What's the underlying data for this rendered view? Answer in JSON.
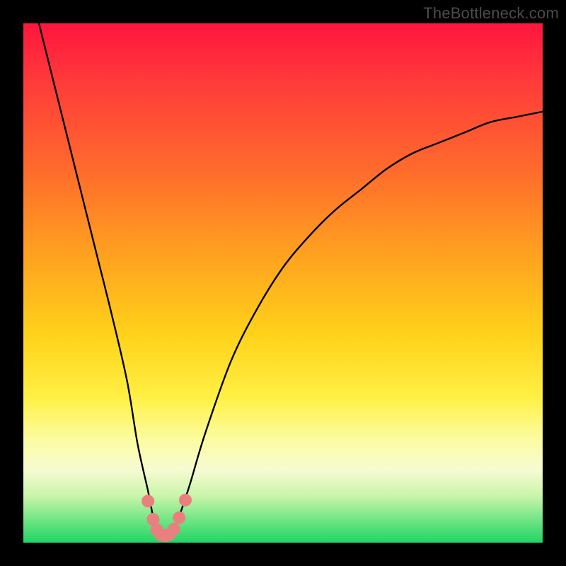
{
  "watermark": "TheBottleneck.com",
  "chart_data": {
    "type": "line",
    "title": "",
    "xlabel": "",
    "ylabel": "",
    "xlim": [
      0,
      100
    ],
    "ylim": [
      0,
      100
    ],
    "series": [
      {
        "name": "bottleneck-curve",
        "x": [
          3,
          5,
          8,
          11,
          14,
          17,
          20,
          22,
          24,
          25,
          26,
          27,
          28,
          29,
          30,
          32,
          35,
          40,
          45,
          50,
          55,
          60,
          65,
          70,
          75,
          80,
          85,
          90,
          95,
          100
        ],
        "y": [
          100,
          92,
          80,
          68,
          56,
          44,
          31,
          19,
          10,
          5,
          2,
          1,
          1,
          2,
          5,
          11,
          21,
          35,
          45,
          53,
          59,
          64,
          68,
          72,
          75,
          77,
          79,
          81,
          82,
          83
        ]
      }
    ],
    "markers": {
      "name": "highlight-dots",
      "color": "#e9807f",
      "x": [
        24.0,
        25.0,
        25.7,
        26.5,
        27.3,
        28.1,
        29.0,
        30.0,
        31.2
      ],
      "y": [
        8.0,
        4.5,
        2.5,
        1.5,
        1.3,
        1.6,
        2.6,
        4.8,
        8.2
      ]
    },
    "gradient_stops": [
      {
        "pos": 0,
        "color": "#ff163e"
      },
      {
        "pos": 12,
        "color": "#ff3d3a"
      },
      {
        "pos": 28,
        "color": "#ff6a2c"
      },
      {
        "pos": 45,
        "color": "#ffa31f"
      },
      {
        "pos": 60,
        "color": "#ffd21a"
      },
      {
        "pos": 72,
        "color": "#fff044"
      },
      {
        "pos": 80,
        "color": "#fcfca0"
      },
      {
        "pos": 86,
        "color": "#f6fbd2"
      },
      {
        "pos": 91,
        "color": "#c9f5a9"
      },
      {
        "pos": 96,
        "color": "#69e481"
      },
      {
        "pos": 100,
        "color": "#1fd565"
      }
    ]
  }
}
